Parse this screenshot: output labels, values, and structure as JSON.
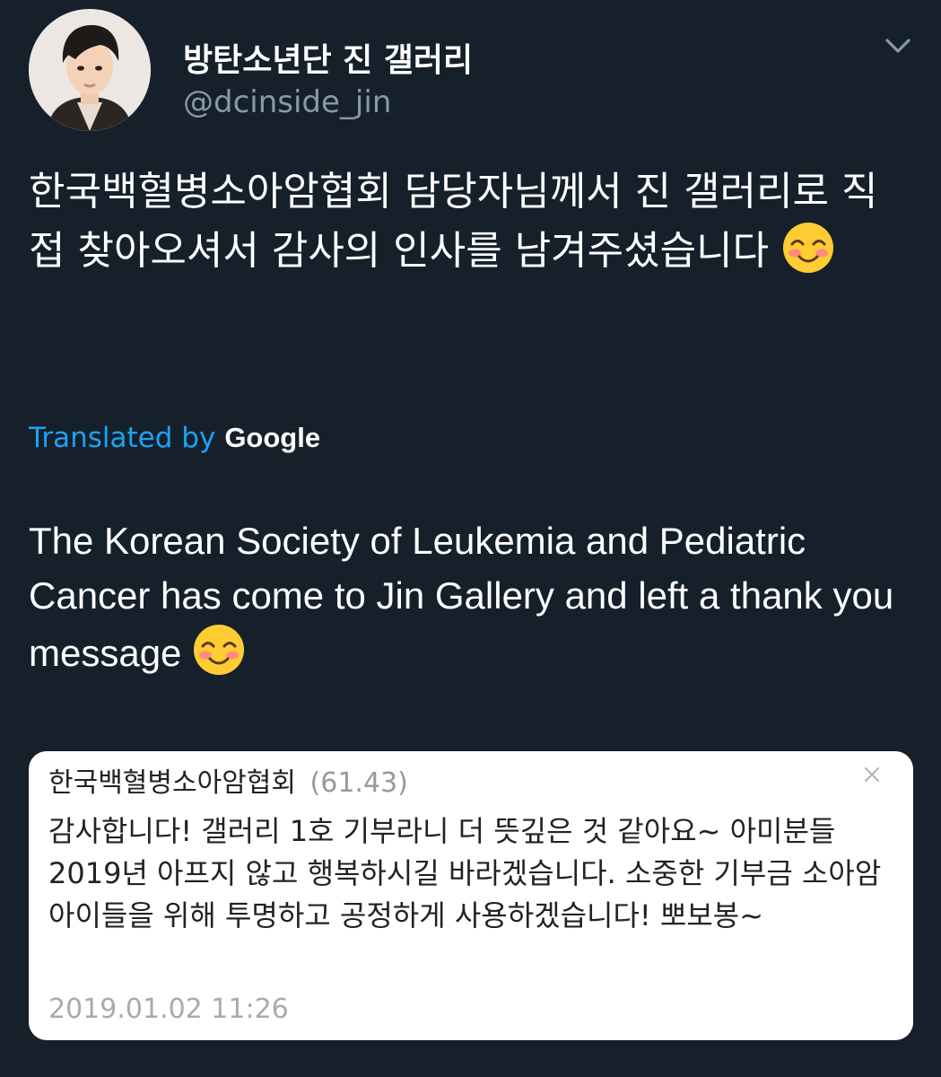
{
  "tweet": {
    "display_name": "방탄소년단 진 갤러리",
    "handle": "@dcinside_jin",
    "text": "한국백혈병소아암협회 담당자님께서 진 갤러리로 직접 찾아오셔서 감사의 인사를 남겨주셨습니다",
    "emoji": "smiling-face-with-blushing-eyes",
    "translated_by_label": "Translated by",
    "translator_brand": "Google",
    "translation": "The Korean Society of Leukemia and Pediatric Cancer has come to Jin Gallery and left a thank you message"
  },
  "quoted_comment": {
    "author": "한국백혈병소아암협회",
    "ip": "(61.43)",
    "body": "감사합니다! 갤러리 1호 기부라니 더 뜻깊은 것 같아요~ 아미분들 2019년 아프지 않고 행복하시길 바라겠습니다. 소중한 기부금 소아암 아이들을 위해 투명하고 공정하게 사용하겠습니다!  뽀보봉~",
    "timestamp": "2019.01.02 11:26"
  },
  "colors": {
    "background": "#15202b",
    "link_blue": "#1da1f2",
    "secondary_text": "#8899a6"
  }
}
